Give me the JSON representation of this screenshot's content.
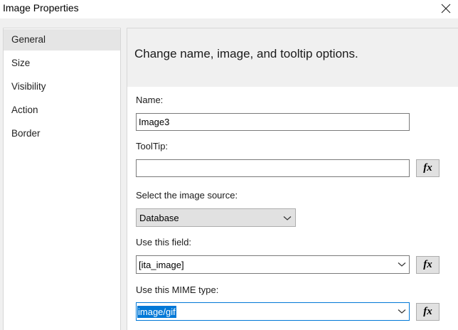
{
  "window": {
    "title": "Image Properties",
    "close_icon": "close-icon"
  },
  "sidebar": {
    "items": [
      {
        "label": "General",
        "selected": true
      },
      {
        "label": "Size",
        "selected": false
      },
      {
        "label": "Visibility",
        "selected": false
      },
      {
        "label": "Action",
        "selected": false
      },
      {
        "label": "Border",
        "selected": false
      }
    ]
  },
  "main": {
    "header": "Change name, image, and tooltip options.",
    "name_label": "Name:",
    "name_value": "Image3",
    "tooltip_label": "ToolTip:",
    "tooltip_value": "",
    "source_label": "Select the image source:",
    "source_value": "Database",
    "field_label": "Use this field:",
    "field_value": "[ita_image]",
    "mime_label": "Use this MIME type:",
    "mime_value": "image/gif",
    "expression_button_label": "fx"
  },
  "colors": {
    "selection": "#0078d7",
    "panel_bg": "#f0f0f0",
    "nav_selected": "#e5e5e5"
  }
}
